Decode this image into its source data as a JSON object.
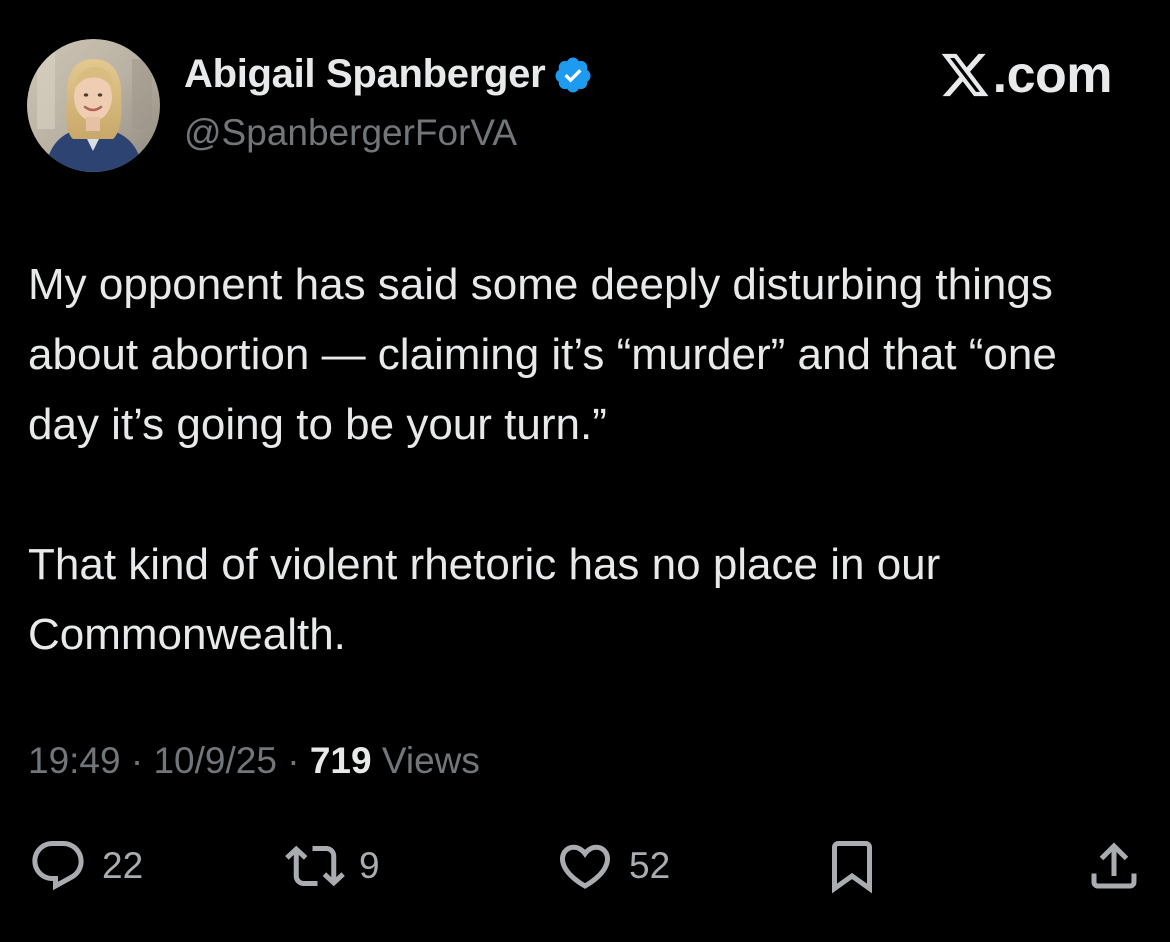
{
  "author": {
    "display_name": "Abigail Spanberger",
    "handle": "@SpanbergerForVA",
    "verified": true,
    "verified_color": "#1d9bf0"
  },
  "brand": {
    "text": ".com",
    "icon": "x-logo-icon"
  },
  "tweet": {
    "paragraphs": [
      "My opponent has said some deeply disturbing things about abortion — claiming it’s “murder” and that “one day it’s going to be your turn.”",
      "That kind of violent rhetoric has no place in our Commonwealth."
    ]
  },
  "meta": {
    "time": "19:49",
    "separator_1": "·",
    "date": "10/9/25",
    "separator_2": "·",
    "views_count": "719",
    "views_label": "Views"
  },
  "actions": {
    "reply": {
      "icon": "reply-icon",
      "count": "22"
    },
    "retweet": {
      "icon": "retweet-icon",
      "count": "9"
    },
    "like": {
      "icon": "heart-icon",
      "count": "52"
    },
    "bookmark": {
      "icon": "bookmark-icon"
    },
    "share": {
      "icon": "share-icon"
    }
  },
  "colors": {
    "background": "#000000",
    "primary_text": "#e7e9ea",
    "secondary_text": "#71767b",
    "verified_badge": "#1d9bf0"
  }
}
